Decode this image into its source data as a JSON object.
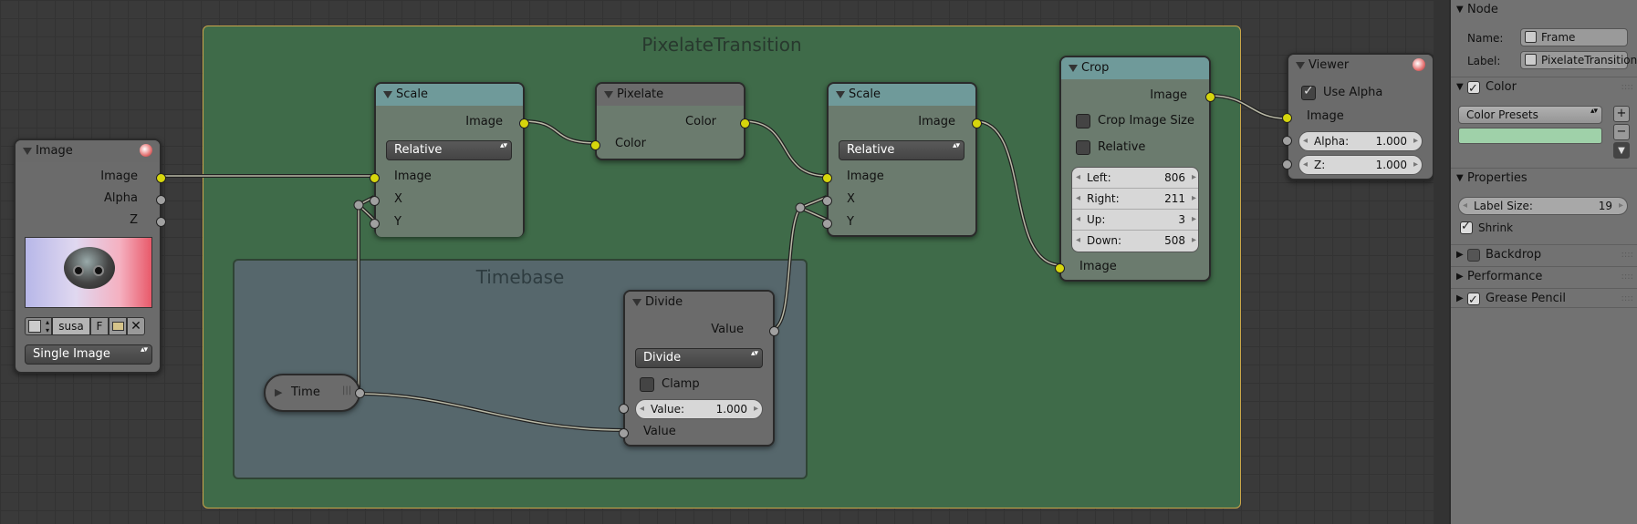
{
  "frames": {
    "main_label": "PixelateTransition",
    "time_label": "Timebase"
  },
  "image_node": {
    "title": "Image",
    "outputs": [
      "Image",
      "Alpha",
      "Z"
    ],
    "file_name": "susa",
    "file_flag": "F",
    "source_type": "Single Image"
  },
  "scale1": {
    "title": "Scale",
    "out_image": "Image",
    "mode": "Relative",
    "in_image": "Image",
    "in_x": "X",
    "in_y": "Y"
  },
  "pixelate": {
    "title": "Pixelate",
    "out_color": "Color",
    "in_color": "Color"
  },
  "scale2": {
    "title": "Scale",
    "out_image": "Image",
    "mode": "Relative",
    "in_image": "Image",
    "in_x": "X",
    "in_y": "Y"
  },
  "crop": {
    "title": "Crop",
    "out_image": "Image",
    "crop_image_size": "Crop Image Size",
    "relative": "Relative",
    "fields": [
      {
        "label": "Left:",
        "value": "806"
      },
      {
        "label": "Right:",
        "value": "211"
      },
      {
        "label": "Up:",
        "value": "3"
      },
      {
        "label": "Down:",
        "value": "508"
      }
    ],
    "in_image": "Image"
  },
  "divide": {
    "title": "Divide",
    "out_value": "Value",
    "operation": "Divide",
    "clamp": "Clamp",
    "value_label": "Value:",
    "value": "1.000",
    "in_value": "Value"
  },
  "time": {
    "title": "Time"
  },
  "viewer": {
    "title": "Viewer",
    "use_alpha": "Use Alpha",
    "in_image": "Image",
    "alpha_label": "Alpha:",
    "alpha_value": "1.000",
    "z_label": "Z:",
    "z_value": "1.000"
  },
  "sidebar": {
    "node_panel": "Node",
    "name_label": "Name:",
    "name_value": "Frame",
    "label_label": "Label:",
    "label_value": "PixelateTransition",
    "color_panel": "Color",
    "color_presets": "Color Presets",
    "color_swatch": "#9fd1a9",
    "properties_panel": "Properties",
    "label_size_label": "Label Size:",
    "label_size_value": "19",
    "shrink": "Shrink",
    "backdrop_panel": "Backdrop",
    "performance_panel": "Performance",
    "grease_pencil_panel": "Grease Pencil"
  }
}
